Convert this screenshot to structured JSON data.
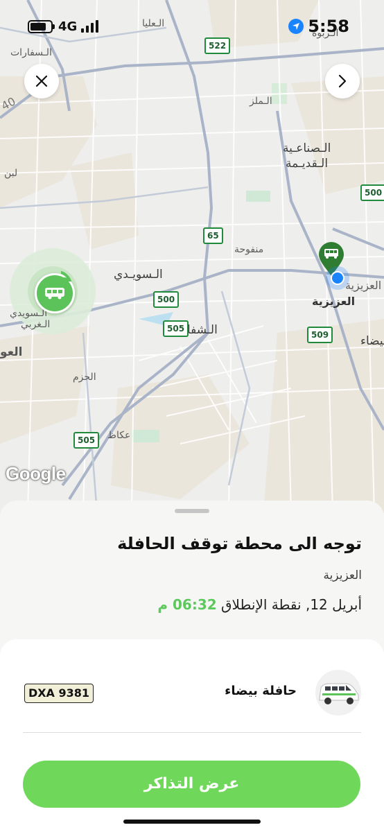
{
  "status_bar": {
    "network": "4G",
    "time": "5:58"
  },
  "map": {
    "labels": [
      "الـعليا",
      "الـسفارات",
      "الـربوة",
      "الـملز",
      "الـصناعـية",
      "الـقديـمة",
      "لبن",
      "منفوحة",
      "الـسويـدي",
      "العزيزية",
      "العزيزية",
      "الـسويدي",
      "الـغربي",
      "الـشفا",
      "العو",
      "الحزم",
      "عكاظ",
      "بيضاء"
    ],
    "road_shields": [
      "522",
      "500",
      "65",
      "500",
      "505",
      "509",
      "505"
    ],
    "road_number": "40",
    "attribution": "Google"
  },
  "sheet": {
    "title": "توجه الى محطة توقف الحافلة",
    "area": "العزيزية",
    "date": "أبريل 12,",
    "departure_label": "نقطة الإنطلاق",
    "departure_time": "06:32 م"
  },
  "vehicle": {
    "name": "حافلة بيضاء",
    "plate": "DXA 9381"
  },
  "cta": {
    "label": "عرض التذاكر"
  },
  "colors": {
    "accent": "#6fd85a",
    "time_green": "#5bc95b",
    "marker_green": "#2e7d32",
    "location_blue": "#1a84ff"
  },
  "icons": [
    "close-icon",
    "chevron-right-icon",
    "location-arrow-icon",
    "bus-icon",
    "wifi-signal-icon"
  ]
}
